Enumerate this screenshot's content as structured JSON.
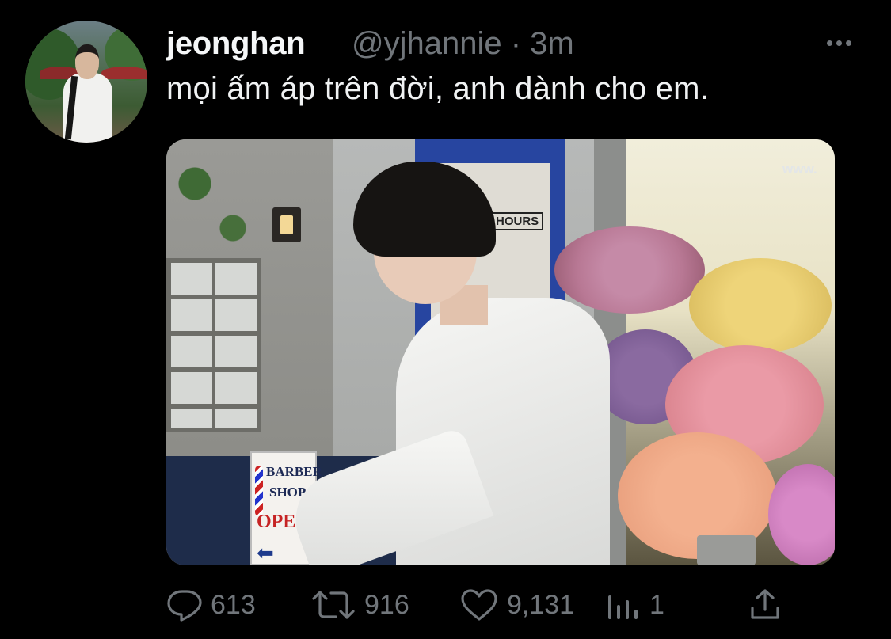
{
  "tweet": {
    "display_name": "jeonghan",
    "handle_time": "@yjhannie · 3m",
    "text": "mọi ấm áp trên đời, anh dành cho em.",
    "more_icon": "more-horizontal-icon"
  },
  "media": {
    "sign_line1": "BARBER",
    "sign_line2": "SHOP",
    "sign_line3": "OPEN",
    "door_sign": "HOURS",
    "wall_text": "www."
  },
  "actions": {
    "replies": "613",
    "retweets": "916",
    "likes": "9,131",
    "views": "1"
  },
  "colors": {
    "background": "#000000",
    "text_primary": "#f0f2f3",
    "text_secondary": "#71767b"
  }
}
